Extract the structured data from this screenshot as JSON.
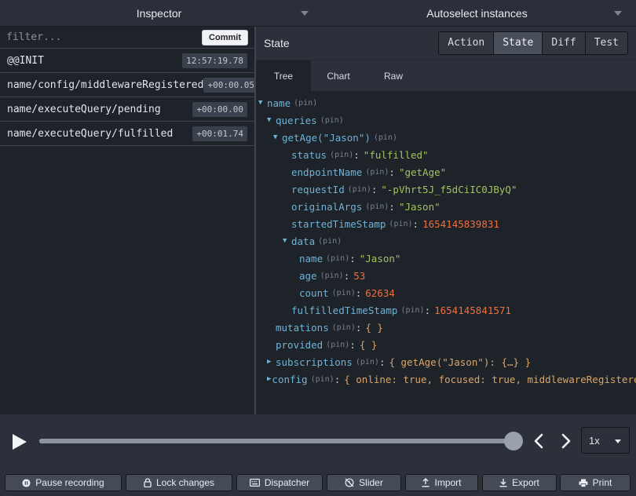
{
  "topbar": {
    "inspector_label": "Inspector",
    "instances_label": "Autoselect instances"
  },
  "left": {
    "filter_placeholder": "filter...",
    "commit_label": "Commit",
    "actions": [
      {
        "name": "@@INIT",
        "time": "12:57:19.78"
      },
      {
        "name": "name/config/middlewareRegistered",
        "time": "+00:00.05"
      },
      {
        "name": "name/executeQuery/pending",
        "time": "+00:00.00"
      },
      {
        "name": "name/executeQuery/fulfilled",
        "time": "+00:01.74"
      }
    ]
  },
  "right": {
    "title": "State",
    "tabs": [
      "Action",
      "State",
      "Diff",
      "Test"
    ],
    "active_tab": "State",
    "subtabs": [
      "Tree",
      "Chart",
      "Raw"
    ],
    "active_subtab": "Tree",
    "pin_label": "(pin)",
    "tree": [
      {
        "arrow": "expanded",
        "key": "name",
        "level": 0
      },
      {
        "arrow": "expanded",
        "key": "queries",
        "level": 1
      },
      {
        "arrow": "expanded",
        "key": "getAge(\"Jason\")",
        "level": 2
      },
      {
        "arrow": "none",
        "key": "status",
        "value": "\"fulfilled\"",
        "type": "str",
        "level": 3
      },
      {
        "arrow": "none",
        "key": "endpointName",
        "value": "\"getAge\"",
        "type": "str",
        "level": 3
      },
      {
        "arrow": "none",
        "key": "requestId",
        "value": "\"-pVhrt5J_f5dCiIC0JByQ\"",
        "type": "str",
        "level": 3
      },
      {
        "arrow": "none",
        "key": "originalArgs",
        "value": "\"Jason\"",
        "type": "str",
        "level": 3
      },
      {
        "arrow": "none",
        "key": "startedTimeStamp",
        "value": "1654145839831",
        "type": "num",
        "level": 3
      },
      {
        "arrow": "expanded",
        "key": "data",
        "level": 3
      },
      {
        "arrow": "none",
        "key": "name",
        "value": "\"Jason\"",
        "type": "str",
        "level": 4
      },
      {
        "arrow": "none",
        "key": "age",
        "value": "53",
        "type": "num",
        "level": 4
      },
      {
        "arrow": "none",
        "key": "count",
        "value": "62634",
        "type": "num",
        "level": 4
      },
      {
        "arrow": "none",
        "key": "fulfilledTimeStamp",
        "value": "1654145841571",
        "type": "num",
        "level": 3
      },
      {
        "arrow": "none",
        "key": "mutations",
        "value": "{ }",
        "type": "obj",
        "level": 1
      },
      {
        "arrow": "none",
        "key": "provided",
        "value": "{ }",
        "type": "obj",
        "level": 1
      },
      {
        "arrow": "collapsed",
        "key": "subscriptions",
        "value": "{ getAge(\"Jason\"): {…} }",
        "type": "obj",
        "level": 1
      },
      {
        "arrow": "collapsed",
        "key": "config",
        "value": "{ online: true, focused: true, middlewareRegistered:",
        "type": "obj",
        "level": 1
      }
    ]
  },
  "player": {
    "progress": 1.0,
    "speed": "1x"
  },
  "bottom": {
    "buttons": [
      {
        "label": "Pause recording",
        "icon": "pause-circle-icon"
      },
      {
        "label": "Lock changes",
        "icon": "lock-icon"
      },
      {
        "label": "Dispatcher",
        "icon": "keyboard-icon"
      },
      {
        "label": "Slider",
        "icon": "history-off-icon"
      },
      {
        "label": "Import",
        "icon": "upload-icon"
      },
      {
        "label": "Export",
        "icon": "download-icon"
      },
      {
        "label": "Print",
        "icon": "print-icon"
      }
    ]
  }
}
